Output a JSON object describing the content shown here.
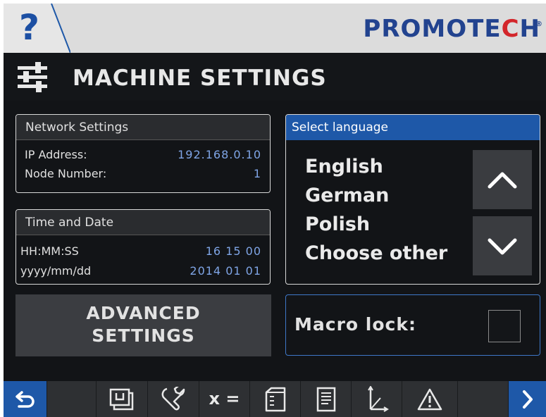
{
  "header": {
    "help_label": "?",
    "logo_text": "PROMOTECH",
    "logo_reg": "®"
  },
  "title": {
    "text": "MACHINE SETTINGS",
    "icon": "sliders-icon"
  },
  "network": {
    "heading": "Network Settings",
    "ip_label": "IP Address:",
    "ip_value": "192.168.0.10",
    "node_label": "Node Number:",
    "node_value": "1"
  },
  "time": {
    "heading": "Time and Date",
    "time_label": "HH:MM:SS",
    "time_value": "16 15 00",
    "date_label": "yyyy/mm/dd",
    "date_value": "2014 01 01"
  },
  "language": {
    "heading": "Select language",
    "options": [
      "English",
      "German",
      "Polish",
      "Choose other"
    ],
    "up_icon": "chevron-up-icon",
    "down_icon": "chevron-down-icon"
  },
  "advanced": {
    "line1": "ADVANCED",
    "line2": "SETTINGS"
  },
  "macro": {
    "label": "Macro lock:",
    "checked": false
  },
  "toolbar": {
    "items": [
      "back-icon",
      "blank",
      "program-icon",
      "wrench-icon",
      "x-equals-icon",
      "folder-icon",
      "document-icon",
      "axis-icon",
      "warning-icon",
      "blank",
      "chevron-right-icon"
    ],
    "x_equals_label": "x ="
  },
  "colors": {
    "accent_blue": "#1e58a8",
    "value_blue": "#7fa5e6",
    "background": "#121417",
    "header_gray": "#dcdcdc",
    "logo_blue": "#22438f",
    "logo_red": "#d3262b"
  }
}
